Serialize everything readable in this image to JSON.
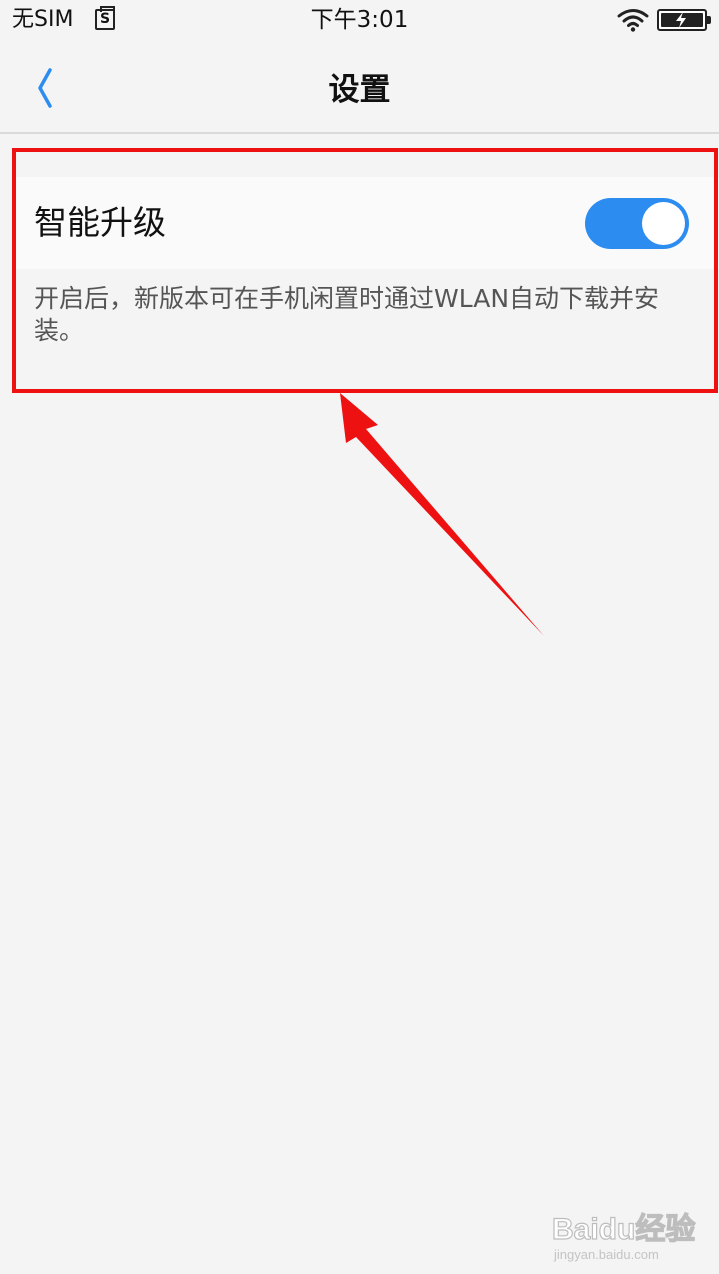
{
  "status_bar": {
    "carrier": "无SIM",
    "sim_icon_letter": "S",
    "time": "下午3:01"
  },
  "nav": {
    "title": "设置"
  },
  "setting": {
    "label": "智能升级",
    "enabled": true,
    "description": "开启后，新版本可在手机闲置时通过WLAN自动下载并安装。"
  },
  "watermark": {
    "brand": "Baidu经验",
    "url": "jingyan.baidu.com"
  },
  "colors": {
    "accent": "#2d8cf0",
    "annotation": "#ee1111",
    "background": "#f4f4f4"
  }
}
